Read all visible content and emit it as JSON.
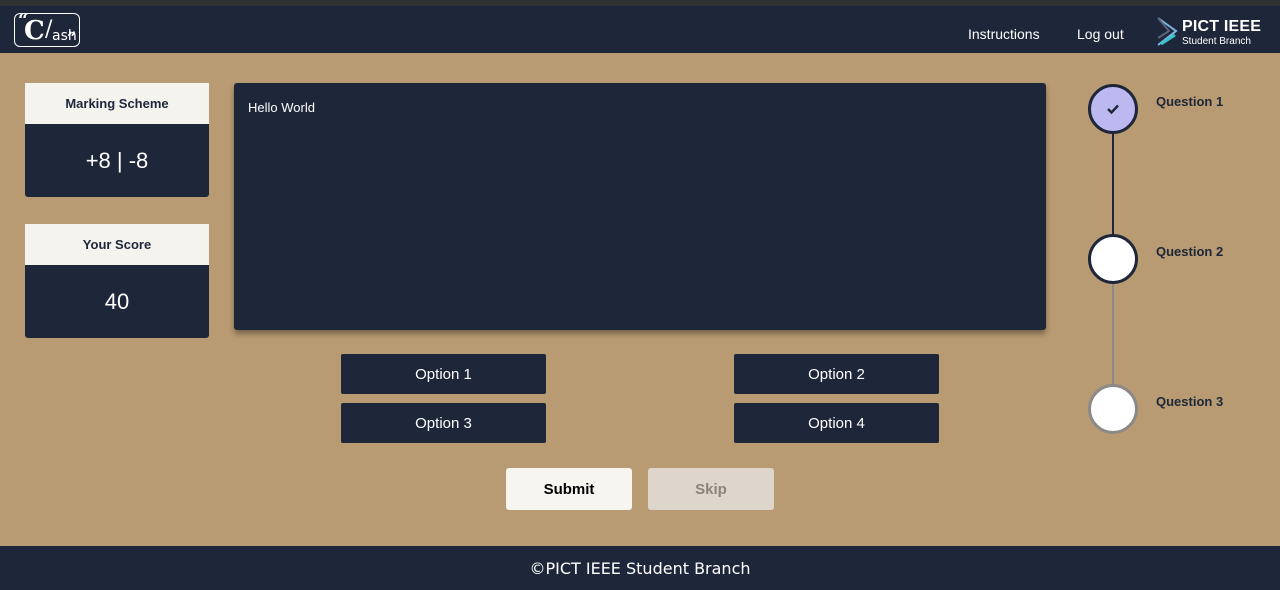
{
  "header": {
    "logo": {
      "quote_open": "“",
      "letter_c": "C",
      "slash": "/",
      "suffix": "ash",
      "quote_close": "”"
    },
    "nav": {
      "instructions": "Instructions",
      "logout": "Log out"
    },
    "brand": {
      "title": "PICT IEEE",
      "subtitle": "Student Branch"
    }
  },
  "sidebar": {
    "marking_scheme": {
      "label": "Marking Scheme",
      "value": "+8 | -8"
    },
    "score": {
      "label": "Your Score",
      "value": "40"
    }
  },
  "question": {
    "text": "Hello World"
  },
  "options": [
    "Option 1",
    "Option 2",
    "Option 3",
    "Option 4"
  ],
  "actions": {
    "submit": "Submit",
    "skip": "Skip"
  },
  "progress": {
    "steps": [
      {
        "label": "Question 1",
        "status": "done",
        "icon": "check-icon"
      },
      {
        "label": "Question 2",
        "status": "current"
      },
      {
        "label": "Question 3",
        "status": "pending"
      }
    ]
  },
  "footer": {
    "text": "©PICT IEEE Student Branch"
  },
  "colors": {
    "primary": "#1e2639",
    "background": "#b89b72",
    "done_step": "#bcb8f0",
    "light": "#f5f3ee"
  }
}
